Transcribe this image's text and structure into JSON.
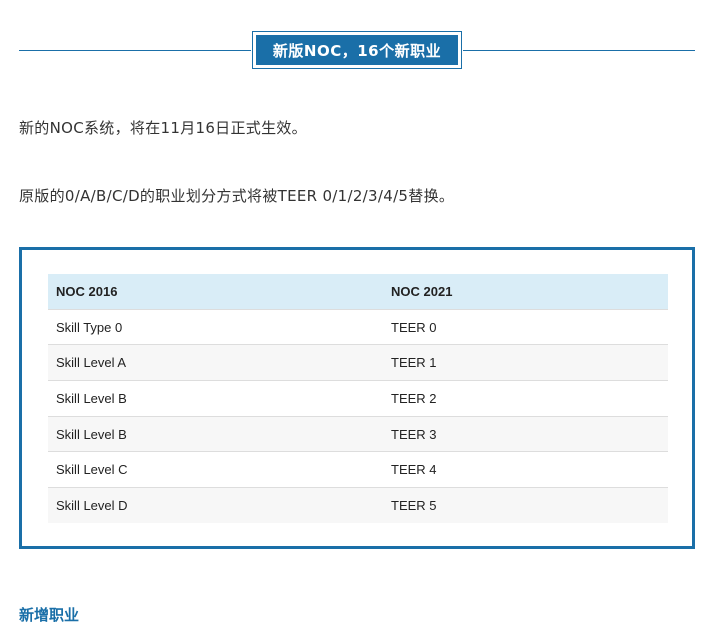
{
  "section": {
    "title": "新版NOC，16个新职业"
  },
  "paragraphs": {
    "p1": "新的NOC系统，将在11月16日正式生效。",
    "p2": "原版的0/A/B/C/D的职业划分方式将被TEER 0/1/2/3/4/5替换。"
  },
  "table": {
    "headers": [
      "NOC 2016",
      "NOC 2021"
    ],
    "rows": [
      [
        "Skill Type 0",
        "TEER 0"
      ],
      [
        "Skill Level A",
        "TEER 1"
      ],
      [
        "Skill Level B",
        "TEER 2"
      ],
      [
        "Skill Level B",
        "TEER 3"
      ],
      [
        "Skill Level C",
        "TEER 4"
      ],
      [
        "Skill Level D",
        "TEER 5"
      ]
    ]
  },
  "subheading": "新增职业",
  "colors": {
    "accent": "#1a6fa8",
    "header_bg": "#d9edf7",
    "stripe": "#f7f7f7",
    "text": "#333333"
  }
}
